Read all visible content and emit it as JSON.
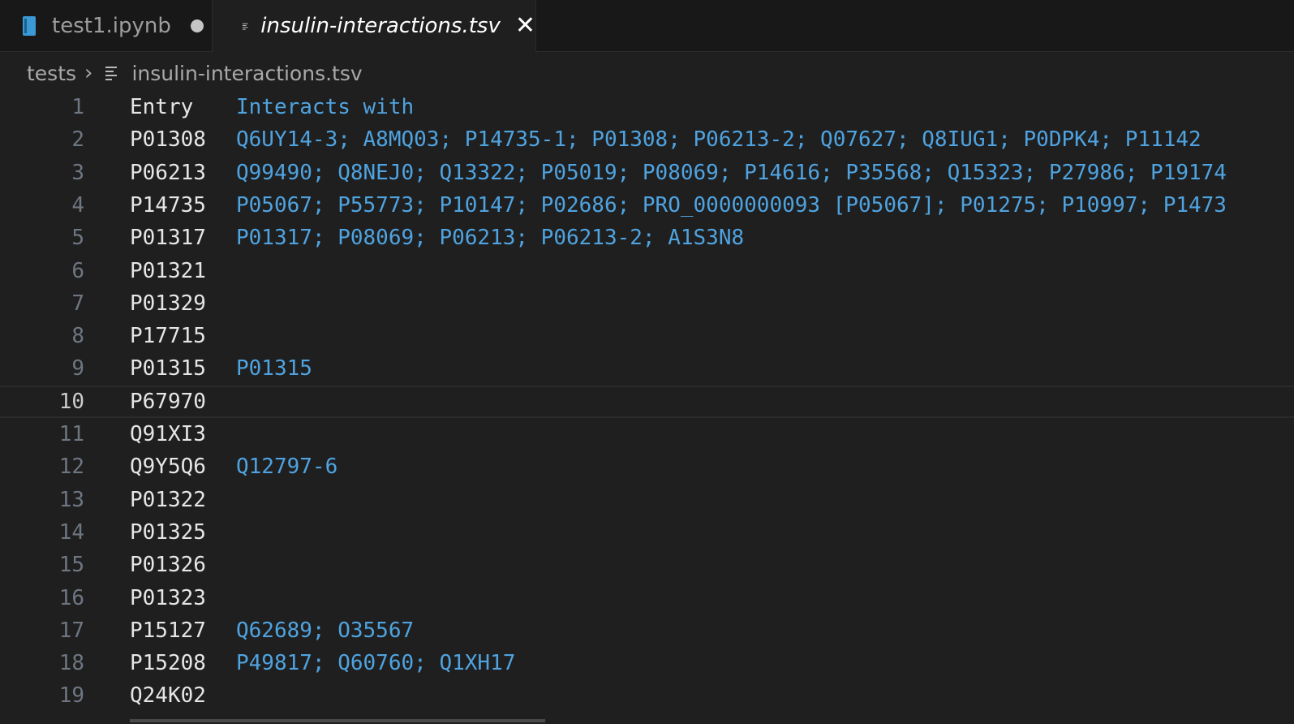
{
  "tabs": [
    {
      "label": "test1.ipynb",
      "icon": "notebook-icon",
      "dirty": true
    },
    {
      "label": "insulin-interactions.tsv",
      "icon": "lines-file-icon",
      "active": true
    }
  ],
  "breadcrumb": {
    "folder": "tests",
    "file": "insulin-interactions.tsv"
  },
  "colors": {
    "entry": "#e6e6e6",
    "interacts": "#4fa3e0",
    "line_number": "#6e7681",
    "background": "#1f1f1f"
  },
  "editor": {
    "current_line": 10,
    "lines": [
      {
        "n": "1",
        "entry": "Entry",
        "interacts": "Interacts with"
      },
      {
        "n": "2",
        "entry": "P01308",
        "interacts": "Q6UY14-3; A8MQ03; P14735-1; P01308; P06213-2; Q07627; Q8IUG1; P0DPK4; P11142"
      },
      {
        "n": "3",
        "entry": "P06213",
        "interacts": "Q99490; Q8NEJ0; Q13322; P05019; P08069; P14616; P35568; Q15323; P27986; P19174"
      },
      {
        "n": "4",
        "entry": "P14735",
        "interacts": "P05067; P55773; P10147; P02686; PRO_0000000093 [P05067]; P01275; P10997; P1473"
      },
      {
        "n": "5",
        "entry": "P01317",
        "interacts": "P01317; P08069; P06213; P06213-2; A1S3N8"
      },
      {
        "n": "6",
        "entry": "P01321",
        "interacts": ""
      },
      {
        "n": "7",
        "entry": "P01329",
        "interacts": ""
      },
      {
        "n": "8",
        "entry": "P17715",
        "interacts": ""
      },
      {
        "n": "9",
        "entry": "P01315",
        "interacts": "P01315"
      },
      {
        "n": "10",
        "entry": "P67970",
        "interacts": ""
      },
      {
        "n": "11",
        "entry": "Q91XI3",
        "interacts": ""
      },
      {
        "n": "12",
        "entry": "Q9Y5Q6",
        "interacts": "Q12797-6"
      },
      {
        "n": "13",
        "entry": "P01322",
        "interacts": ""
      },
      {
        "n": "14",
        "entry": "P01325",
        "interacts": ""
      },
      {
        "n": "15",
        "entry": "P01326",
        "interacts": ""
      },
      {
        "n": "16",
        "entry": "P01323",
        "interacts": ""
      },
      {
        "n": "17",
        "entry": "P15127",
        "interacts": "Q62689; O35567"
      },
      {
        "n": "18",
        "entry": "P15208",
        "interacts": "P49817; Q60760; Q1XH17"
      },
      {
        "n": "19",
        "entry": "Q24K02",
        "interacts": ""
      }
    ]
  }
}
